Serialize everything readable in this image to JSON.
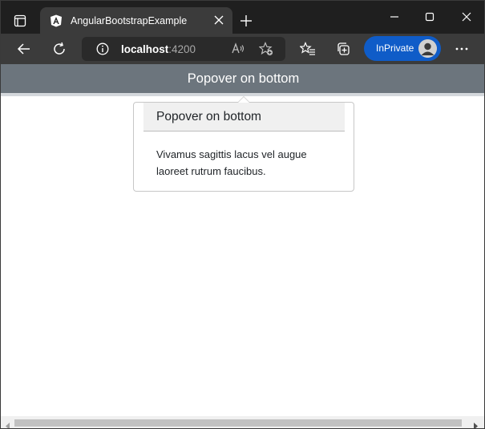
{
  "browser": {
    "tab": {
      "title": "AngularBootstrapExample",
      "favicon": "angular-logo-icon"
    },
    "address": {
      "host": "localhost",
      "port": ":4200"
    },
    "inprivate_label": "InPrivate",
    "icons": [
      "tab-actions-icon",
      "close-icon",
      "plus-icon",
      "minimize-icon",
      "maximize-icon",
      "back-arrow-icon",
      "refresh-icon",
      "info-icon",
      "read-aloud-icon",
      "add-favorite-icon",
      "favorites-icon",
      "collections-icon",
      "more-icon"
    ]
  },
  "page": {
    "trigger_button": "Popover on bottom",
    "popover": {
      "header": "Popover on bottom",
      "body": "Vivamus sagittis lacus vel augue laoreet rutrum faucibus."
    }
  },
  "colors": {
    "trigger_bg": "#6c757d",
    "inprivate_bg": "#0f5cc8",
    "titlebar_bg": "#1f1f1f",
    "toolbar_bg": "#3b3b3b"
  }
}
